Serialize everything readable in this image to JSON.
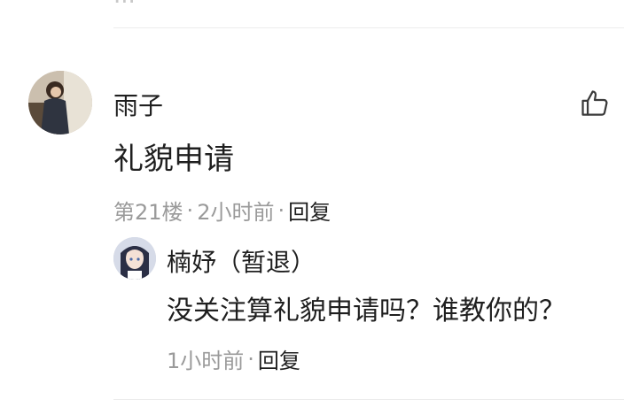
{
  "top_clipped_text": "...",
  "comment": {
    "username": "雨子",
    "text": "礼貌申请",
    "floor": "第21楼",
    "separator": "·",
    "time": "2小时前",
    "reply_label": "回复",
    "icons": {
      "avatar": "user-avatar",
      "like": "thumbs-up-icon"
    }
  },
  "reply": {
    "username": "楠妤（暂退）",
    "text": "没关注算礼貌申请吗？谁教你的？",
    "separator": "·",
    "time": "1小时前",
    "reply_label": "回复",
    "icons": {
      "avatar": "user-avatar"
    }
  },
  "colors": {
    "text_primary": "#1f1f1f",
    "text_meta": "#9a9a9a",
    "divider": "#ececec"
  }
}
